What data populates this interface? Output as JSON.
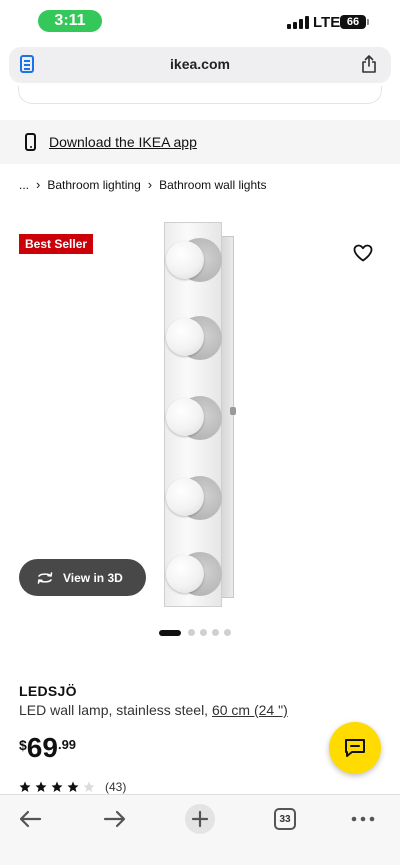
{
  "status_bar": {
    "time": "3:11",
    "network": "LTE",
    "battery": "66"
  },
  "browser": {
    "url": "ikea.com",
    "open_tabs": "33"
  },
  "app_banner": {
    "link_text": "Download the IKEA app"
  },
  "breadcrumb": {
    "items": [
      "...",
      "Bathroom lighting",
      "Bathroom wall lights"
    ]
  },
  "product": {
    "badge": "Best Seller",
    "view_3d_label": "View in 3D",
    "name": "LEDSJÖ",
    "description": "LED wall lamp, stainless steel,",
    "size_link": "60 cm (24 \")",
    "price_currency": "$",
    "price_int": "69",
    "price_dec": ".99",
    "rating_stars": 4,
    "rating_max": 5,
    "review_count": "(43)",
    "image_count": 5,
    "active_image": 1
  },
  "colors": {
    "ikea_red": "#cc0008",
    "chat_yellow": "#ffdb00",
    "status_green": "#34c759"
  },
  "icons": [
    "page-icon",
    "share-icon",
    "phone-icon",
    "heart-icon",
    "rotate-3d-icon",
    "chat-icon",
    "back-arrow-icon",
    "forward-arrow-icon",
    "plus-icon",
    "tabs-icon",
    "more-icon"
  ]
}
